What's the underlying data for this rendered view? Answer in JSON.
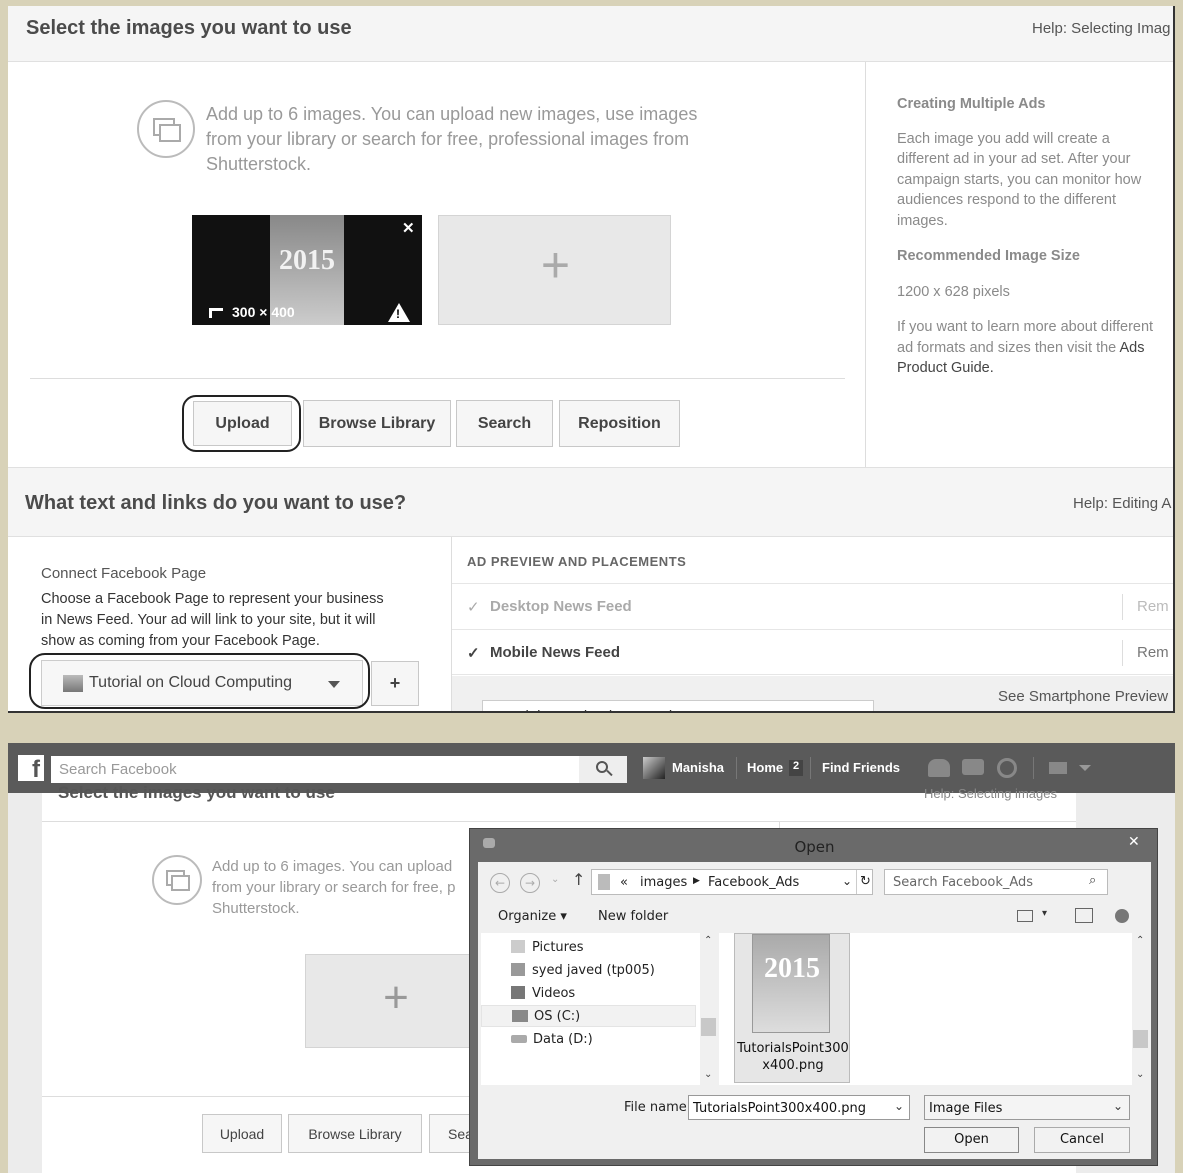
{
  "top": {
    "section1_title": "Select the images you want to use",
    "help1": "Help: Selecting Imag",
    "intro_text_l1": "Add up to 6 images. You can upload new images, use images",
    "intro_text_l2": "from your library or search for free, professional images from",
    "intro_text_l3": "Shutterstock.",
    "thumb": {
      "year": "2015",
      "size_label": "300 × 400",
      "close": "✕",
      "warn": "!"
    },
    "add_tile": "+",
    "buttons": {
      "upload": "Upload",
      "browse": "Browse Library",
      "search": "Search",
      "reposition": "Reposition"
    },
    "side": {
      "h1": "Creating Multiple Ads",
      "p1": [
        "Each image you add will create a",
        "different ad in your ad set. After your",
        "campaign starts, you can monitor how",
        "audiences respond to the different",
        "images."
      ],
      "h2": "Recommended Image Size",
      "size": "1200 x 628 pixels",
      "p2": [
        "If you want to learn more about different",
        "ad formats and sizes then visit the ",
        "Product Guide."
      ],
      "ads_link": "Ads"
    },
    "section2_title": "What text and links do you want to use?",
    "help2": "Help: Editing A",
    "connect_label": "Connect Facebook Page",
    "connect_desc": [
      "Choose a Facebook Page to represent your business",
      "in News Feed. Your ad will link to your site, but it will",
      "show as coming from your Facebook Page."
    ],
    "page_select": "Tutorial on Cloud Computing",
    "plus": "+",
    "preview_header": "AD PREVIEW AND PLACEMENTS",
    "placements": [
      {
        "label": "Desktop News Feed",
        "remove": "Rem"
      },
      {
        "label": "Mobile News Feed",
        "remove": "Rem"
      }
    ],
    "smartphone": "See Smartphone Preview",
    "partial_text": "Tutorials on Cloud Computing"
  },
  "bottom": {
    "fb_logo": "f",
    "search_placeholder": "Search Facebook",
    "nav": {
      "user": "Manisha",
      "home": "Home",
      "home_count": "2",
      "find": "Find Friends"
    },
    "bg_title": "Select the images you want to use",
    "bg_help": "Help: Selecting images",
    "bg_intro": [
      "Add up to 6 images. You can upload",
      "from your library or search for free, p",
      "Shutterstock."
    ],
    "bg_plus": "+",
    "bg_buttons": {
      "upload": "Upload",
      "browse": "Browse Library",
      "search": "Sea"
    },
    "dialog": {
      "title": "Open",
      "close": "✕",
      "path": [
        "«",
        "images",
        "Facebook_Ads"
      ],
      "search_placeholder": "Search Facebook_Ads",
      "organize": "Organize",
      "new_folder": "New folder",
      "tree": [
        "Pictures",
        "syed javed (tp005)",
        "Videos",
        "OS (C:)",
        "Data (D:)"
      ],
      "file_name_l1": "TutorialsPoint300",
      "file_name_l2": "x400.png",
      "filename_label": "File name:",
      "filename_value": "TutorialsPoint300x400.png",
      "filter": "Image Files",
      "open": "Open",
      "cancel": "Cancel"
    }
  }
}
